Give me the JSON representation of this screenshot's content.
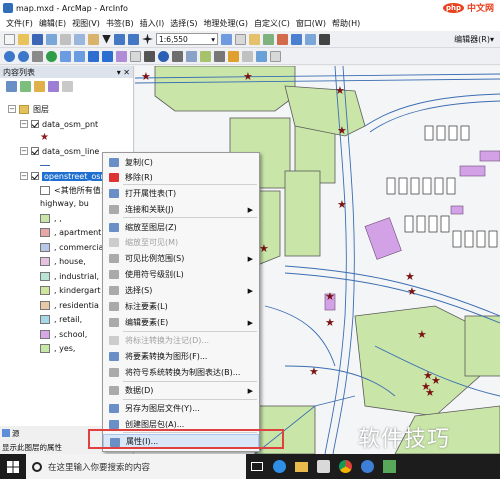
{
  "window": {
    "title": "map.mxd - ArcMap - ArcInfo"
  },
  "logo": {
    "badge": "php",
    "text": "中文网"
  },
  "menu": [
    "文件(F)",
    "编辑(E)",
    "视图(V)",
    "书签(B)",
    "插入(I)",
    "选择(S)",
    "地理处理(G)",
    "自定义(C)",
    "窗口(W)",
    "帮助(H)"
  ],
  "toolbar": {
    "scale_value": "1:6,550",
    "editor_label": "编辑器(R)▾"
  },
  "toc": {
    "title": "内容列表",
    "layers_group": "图层",
    "layers": [
      {
        "name": "data_osm_pnt"
      },
      {
        "name": "data_osm_line"
      },
      {
        "name": "openstreet_osm"
      }
    ],
    "field_label": "<其他所有值>",
    "field_name": "highway, bu",
    "legend": [
      {
        "label": ", ,",
        "color": "#c9e6a8"
      },
      {
        "label": ", apartment",
        "color": "#e8a7a7"
      },
      {
        "label": ", commercia",
        "color": "#b7c7e8"
      },
      {
        "label": ", house,",
        "color": "#e7c2e0"
      },
      {
        "label": ", industrial,",
        "color": "#b8e3d6"
      },
      {
        "label": ", kindergart",
        "color": "#cfe6a1"
      },
      {
        "label": ", residentia",
        "color": "#e8c9a7"
      },
      {
        "label": ", retail,",
        "color": "#a7d8e8"
      },
      {
        "label": ", school,",
        "color": "#d8a7e8"
      },
      {
        "label": ", yes,",
        "color": "#c8e8a7"
      }
    ]
  },
  "status": {
    "tab": "源",
    "text": "显示此图层的属性"
  },
  "context_menu": {
    "items": [
      {
        "label": "复制(C)",
        "color": "#6a8fc7"
      },
      {
        "label": "移除(R)",
        "color": "#d33"
      },
      {
        "label": "打开属性表(T)",
        "color": "#6a8fc7"
      },
      {
        "label": "连接和关联(J)",
        "color": "#aaa",
        "arrow": true
      },
      {
        "label": "缩放至图层(Z)",
        "color": "#6a8fc7"
      },
      {
        "label": "缩放至可见(M)",
        "color": "#ccc",
        "disabled": true
      },
      {
        "label": "可见比例范围(S)",
        "color": "#aaa",
        "arrow": true
      },
      {
        "label": "使用符号级别(L)",
        "color": "#aaa"
      },
      {
        "label": "选择(S)",
        "color": "#aaa",
        "arrow": true
      },
      {
        "label": "标注要素(L)",
        "color": "#aaa"
      },
      {
        "label": "编辑要素(E)",
        "color": "#aaa",
        "arrow": true
      },
      {
        "label": "将标注转换为注记(D)...",
        "color": "#ccc",
        "disabled": true
      },
      {
        "label": "将要素转换为图形(F)...",
        "color": "#6a8fc7"
      },
      {
        "label": "将符号系统转换为制图表达(B)...",
        "color": "#aaa"
      },
      {
        "label": "数据(D)",
        "color": "#aaa",
        "arrow": true
      },
      {
        "label": "另存为图层文件(Y)...",
        "color": "#6a8fc7"
      },
      {
        "label": "创建图层包(A)...",
        "color": "#6a8fc7"
      },
      {
        "label": "属性(I)...",
        "color": "#6a8fc7",
        "highlight": true
      }
    ]
  },
  "taskbar": {
    "search_placeholder": "在这里输入你要搜索的内容"
  },
  "watermark": "软件技巧"
}
